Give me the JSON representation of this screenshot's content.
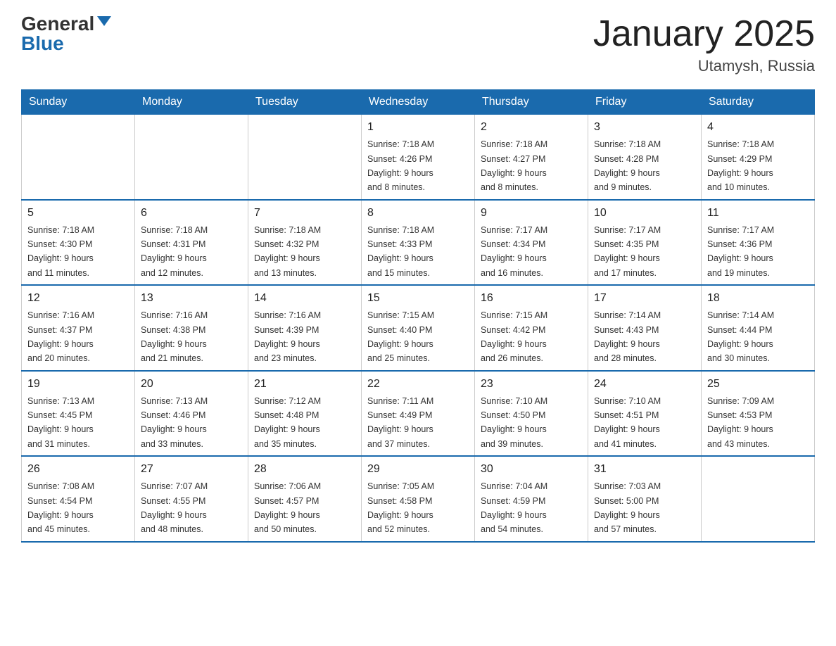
{
  "logo": {
    "general": "General",
    "triangle": "▲",
    "blue": "Blue"
  },
  "header": {
    "title": "January 2025",
    "subtitle": "Utamysh, Russia"
  },
  "days_of_week": [
    "Sunday",
    "Monday",
    "Tuesday",
    "Wednesday",
    "Thursday",
    "Friday",
    "Saturday"
  ],
  "weeks": [
    [
      {
        "day": "",
        "info": ""
      },
      {
        "day": "",
        "info": ""
      },
      {
        "day": "",
        "info": ""
      },
      {
        "day": "1",
        "info": "Sunrise: 7:18 AM\nSunset: 4:26 PM\nDaylight: 9 hours\nand 8 minutes."
      },
      {
        "day": "2",
        "info": "Sunrise: 7:18 AM\nSunset: 4:27 PM\nDaylight: 9 hours\nand 8 minutes."
      },
      {
        "day": "3",
        "info": "Sunrise: 7:18 AM\nSunset: 4:28 PM\nDaylight: 9 hours\nand 9 minutes."
      },
      {
        "day": "4",
        "info": "Sunrise: 7:18 AM\nSunset: 4:29 PM\nDaylight: 9 hours\nand 10 minutes."
      }
    ],
    [
      {
        "day": "5",
        "info": "Sunrise: 7:18 AM\nSunset: 4:30 PM\nDaylight: 9 hours\nand 11 minutes."
      },
      {
        "day": "6",
        "info": "Sunrise: 7:18 AM\nSunset: 4:31 PM\nDaylight: 9 hours\nand 12 minutes."
      },
      {
        "day": "7",
        "info": "Sunrise: 7:18 AM\nSunset: 4:32 PM\nDaylight: 9 hours\nand 13 minutes."
      },
      {
        "day": "8",
        "info": "Sunrise: 7:18 AM\nSunset: 4:33 PM\nDaylight: 9 hours\nand 15 minutes."
      },
      {
        "day": "9",
        "info": "Sunrise: 7:17 AM\nSunset: 4:34 PM\nDaylight: 9 hours\nand 16 minutes."
      },
      {
        "day": "10",
        "info": "Sunrise: 7:17 AM\nSunset: 4:35 PM\nDaylight: 9 hours\nand 17 minutes."
      },
      {
        "day": "11",
        "info": "Sunrise: 7:17 AM\nSunset: 4:36 PM\nDaylight: 9 hours\nand 19 minutes."
      }
    ],
    [
      {
        "day": "12",
        "info": "Sunrise: 7:16 AM\nSunset: 4:37 PM\nDaylight: 9 hours\nand 20 minutes."
      },
      {
        "day": "13",
        "info": "Sunrise: 7:16 AM\nSunset: 4:38 PM\nDaylight: 9 hours\nand 21 minutes."
      },
      {
        "day": "14",
        "info": "Sunrise: 7:16 AM\nSunset: 4:39 PM\nDaylight: 9 hours\nand 23 minutes."
      },
      {
        "day": "15",
        "info": "Sunrise: 7:15 AM\nSunset: 4:40 PM\nDaylight: 9 hours\nand 25 minutes."
      },
      {
        "day": "16",
        "info": "Sunrise: 7:15 AM\nSunset: 4:42 PM\nDaylight: 9 hours\nand 26 minutes."
      },
      {
        "day": "17",
        "info": "Sunrise: 7:14 AM\nSunset: 4:43 PM\nDaylight: 9 hours\nand 28 minutes."
      },
      {
        "day": "18",
        "info": "Sunrise: 7:14 AM\nSunset: 4:44 PM\nDaylight: 9 hours\nand 30 minutes."
      }
    ],
    [
      {
        "day": "19",
        "info": "Sunrise: 7:13 AM\nSunset: 4:45 PM\nDaylight: 9 hours\nand 31 minutes."
      },
      {
        "day": "20",
        "info": "Sunrise: 7:13 AM\nSunset: 4:46 PM\nDaylight: 9 hours\nand 33 minutes."
      },
      {
        "day": "21",
        "info": "Sunrise: 7:12 AM\nSunset: 4:48 PM\nDaylight: 9 hours\nand 35 minutes."
      },
      {
        "day": "22",
        "info": "Sunrise: 7:11 AM\nSunset: 4:49 PM\nDaylight: 9 hours\nand 37 minutes."
      },
      {
        "day": "23",
        "info": "Sunrise: 7:10 AM\nSunset: 4:50 PM\nDaylight: 9 hours\nand 39 minutes."
      },
      {
        "day": "24",
        "info": "Sunrise: 7:10 AM\nSunset: 4:51 PM\nDaylight: 9 hours\nand 41 minutes."
      },
      {
        "day": "25",
        "info": "Sunrise: 7:09 AM\nSunset: 4:53 PM\nDaylight: 9 hours\nand 43 minutes."
      }
    ],
    [
      {
        "day": "26",
        "info": "Sunrise: 7:08 AM\nSunset: 4:54 PM\nDaylight: 9 hours\nand 45 minutes."
      },
      {
        "day": "27",
        "info": "Sunrise: 7:07 AM\nSunset: 4:55 PM\nDaylight: 9 hours\nand 48 minutes."
      },
      {
        "day": "28",
        "info": "Sunrise: 7:06 AM\nSunset: 4:57 PM\nDaylight: 9 hours\nand 50 minutes."
      },
      {
        "day": "29",
        "info": "Sunrise: 7:05 AM\nSunset: 4:58 PM\nDaylight: 9 hours\nand 52 minutes."
      },
      {
        "day": "30",
        "info": "Sunrise: 7:04 AM\nSunset: 4:59 PM\nDaylight: 9 hours\nand 54 minutes."
      },
      {
        "day": "31",
        "info": "Sunrise: 7:03 AM\nSunset: 5:00 PM\nDaylight: 9 hours\nand 57 minutes."
      },
      {
        "day": "",
        "info": ""
      }
    ]
  ]
}
